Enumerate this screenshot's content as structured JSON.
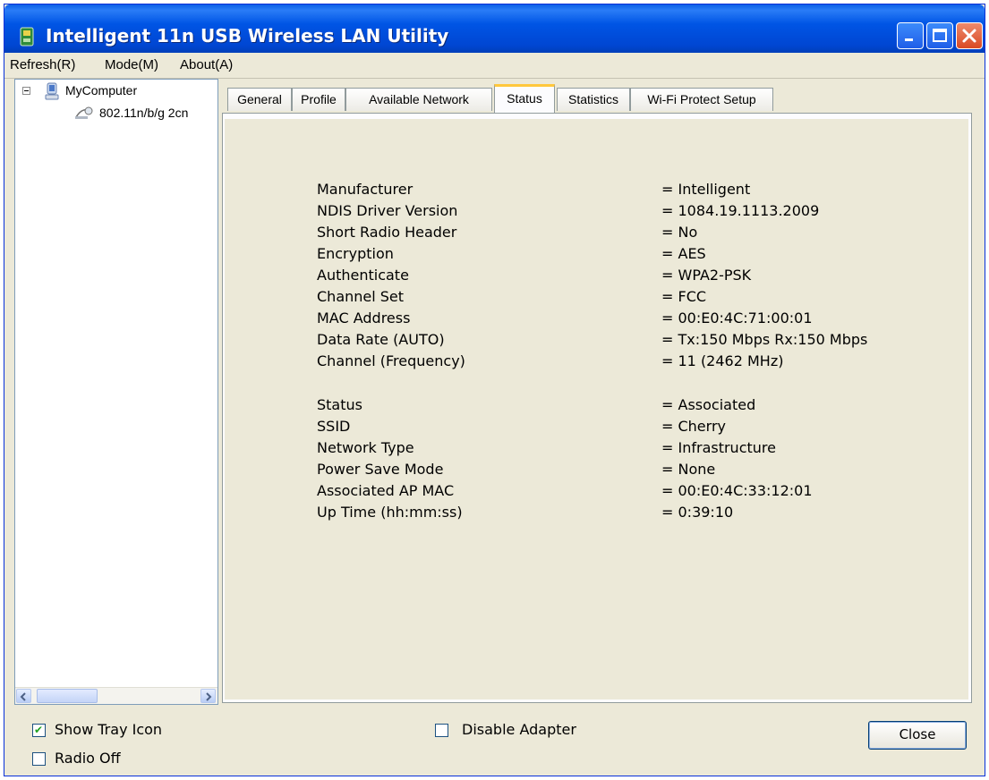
{
  "window": {
    "title": "Intelligent 11n USB Wireless LAN Utility"
  },
  "menu": {
    "items": [
      "Refresh(R)",
      "Mode(M)",
      "About(A)"
    ]
  },
  "tree": {
    "root": "MyComputer",
    "child": "802.11n/b/g 2cn"
  },
  "tabs": [
    {
      "label": "General"
    },
    {
      "label": "Profile"
    },
    {
      "label": "Available Network"
    },
    {
      "label": "Status"
    },
    {
      "label": "Statistics"
    },
    {
      "label": "Wi-Fi Protect Setup"
    }
  ],
  "active_tab": "Status",
  "status": {
    "group1": [
      {
        "label": "Manufacturer",
        "value": "= Intelligent"
      },
      {
        "label": "NDIS Driver Version",
        "value": "= 1084.19.1113.2009"
      },
      {
        "label": "Short Radio Header",
        "value": "= No"
      },
      {
        "label": "Encryption",
        "value": "= AES"
      },
      {
        "label": "Authenticate",
        "value": "= WPA2-PSK"
      },
      {
        "label": "Channel Set",
        "value": "= FCC"
      },
      {
        "label": "MAC Address",
        "value": "= 00:E0:4C:71:00:01"
      },
      {
        "label": "Data Rate (AUTO)",
        "value": "= Tx:150 Mbps Rx:150 Mbps"
      },
      {
        "label": "Channel (Frequency)",
        "value": "= 11 (2462 MHz)"
      }
    ],
    "group2": [
      {
        "label": "Status",
        "value": "= Associated"
      },
      {
        "label": "SSID",
        "value": "= Cherry"
      },
      {
        "label": "Network Type",
        "value": "= Infrastructure"
      },
      {
        "label": "Power Save Mode",
        "value": "= None"
      },
      {
        "label": "Associated AP MAC",
        "value": "= 00:E0:4C:33:12:01"
      },
      {
        "label": "Up Time (hh:mm:ss)",
        "value": "= 0:39:10"
      }
    ]
  },
  "options": {
    "show_tray_icon": {
      "label": "Show Tray Icon",
      "checked": true
    },
    "radio_off": {
      "label": "Radio Off",
      "checked": false
    },
    "disable_adapter": {
      "label": "Disable Adapter",
      "checked": false
    }
  },
  "buttons": {
    "close": "Close"
  },
  "colors": {
    "titlebar": "#0055e5",
    "face": "#ece9d8",
    "active_tab_accent": "#ffc83c"
  }
}
